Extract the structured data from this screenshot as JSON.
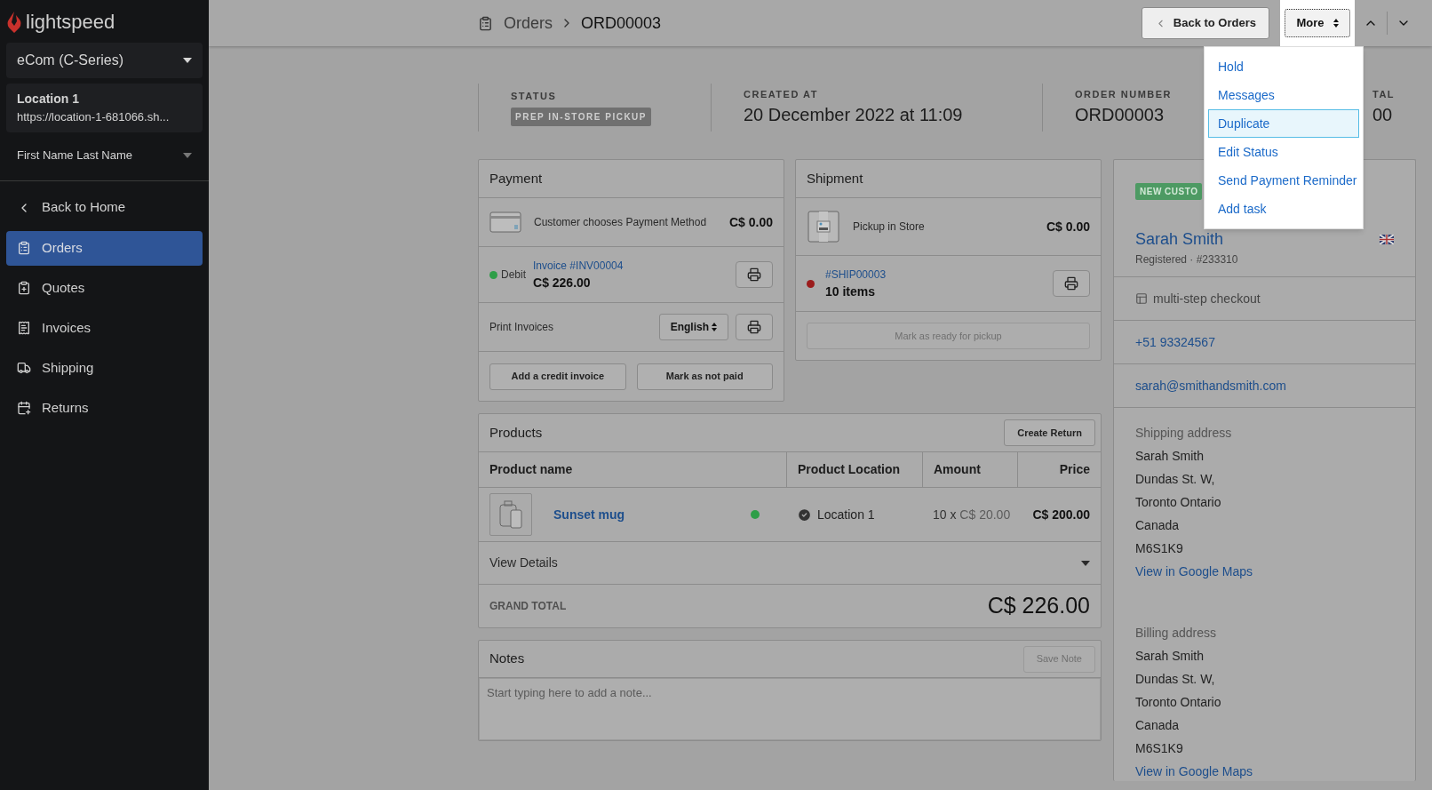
{
  "sidebar": {
    "logo": "lightspeed",
    "store_selector": "eCom (C-Series)",
    "location": {
      "name": "Location 1",
      "url": "https://location-1-681066.sh..."
    },
    "user": "First Name Last Name",
    "back": "Back to Home",
    "items": [
      {
        "label": "Orders",
        "selected": true
      },
      {
        "label": "Quotes",
        "selected": false
      },
      {
        "label": "Invoices",
        "selected": false
      },
      {
        "label": "Shipping",
        "selected": false
      },
      {
        "label": "Returns",
        "selected": false
      }
    ]
  },
  "header": {
    "breadcrumb": [
      "Orders",
      "ORD00003"
    ],
    "back_button": "Back to Orders",
    "more_button": "More"
  },
  "more_menu": {
    "items": [
      {
        "label": "Hold",
        "selected": false
      },
      {
        "label": "Messages",
        "selected": false
      },
      {
        "label": "Duplicate",
        "selected": true
      },
      {
        "label": "Edit Status",
        "selected": false
      },
      {
        "label": "Send Payment Reminder",
        "selected": false
      },
      {
        "label": "Add task",
        "selected": false
      }
    ]
  },
  "summary": [
    {
      "kind": "badge",
      "label": "STATUS",
      "value": "PREP IN-STORE PICKUP"
    },
    {
      "kind": "text",
      "label": "CREATED AT",
      "value": "20 December 2022 at 11:09"
    },
    {
      "kind": "text",
      "label": "ORDER NUMBER",
      "value": "ORD00003"
    },
    {
      "kind": "text",
      "label": "TAL",
      "value": "00"
    }
  ],
  "payment": {
    "title": "Payment",
    "method": {
      "label": "Customer chooses Payment Method",
      "amount": "C$ 0.00"
    },
    "invoice": {
      "method": "Debit",
      "color": "#2e9e48",
      "link": "Invoice #INV00004",
      "amount": "C$ 226.00"
    },
    "print": {
      "label": "Print Invoices",
      "language": "English"
    },
    "buttons": [
      "Add a credit invoice",
      "Mark as not paid"
    ]
  },
  "shipment": {
    "title": "Shipment",
    "method": {
      "label": "Pickup in Store",
      "amount": "C$ 0.00"
    },
    "shipment": {
      "link": "#SHIP00003",
      "items": "10 items",
      "color": "#9b1c1c"
    },
    "button": {
      "label": "Mark as ready for pickup",
      "disabled": true
    }
  },
  "products": {
    "title": "Products",
    "create_return": "Create Return",
    "columns": [
      "Product name",
      "Product Location",
      "Amount",
      "Price"
    ],
    "rows": [
      {
        "name": "Sunset mug",
        "color": "#2e9e48",
        "location": "Location 1",
        "quantity": "10 x",
        "unit_price": "C$ 20.00",
        "price": "C$ 200.00"
      }
    ],
    "details": "View Details",
    "grand_total": {
      "label": "GRAND TOTAL",
      "value": "C$ 226.00"
    }
  },
  "notes": {
    "title": "Notes",
    "save": {
      "label": "Save Note",
      "disabled": true
    },
    "placeholder": "Start typing here to add a note..."
  },
  "customer": {
    "badge": "NEW CUSTO",
    "name": "Sarah Smith",
    "registered": "Registered · #233310",
    "checkout": "multi-step checkout",
    "phone": "+51 93324567",
    "email": "sarah@smithandsmith.com",
    "addresses": [
      {
        "title": "Shipping address",
        "lines": [
          "Sarah Smith",
          "Dundas St. W,",
          "Toronto Ontario",
          "Canada",
          "M6S1K9"
        ],
        "map_link": "View in Google Maps"
      },
      {
        "title": "Billing address",
        "lines": [
          "Sarah Smith",
          "Dundas St. W,",
          "Toronto Ontario",
          "Canada",
          "M6S1K9"
        ],
        "map_link": "View in Google Maps"
      }
    ]
  }
}
